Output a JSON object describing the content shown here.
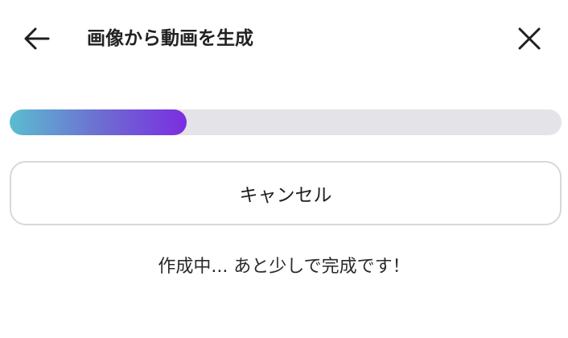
{
  "header": {
    "title": "画像から動画を生成",
    "back_icon": "arrow-left-icon",
    "close_icon": "close-icon"
  },
  "progress": {
    "value_percent": 32,
    "gradient_colors": [
      "#5bbdd0",
      "#6d6fd2",
      "#7a2ee0"
    ],
    "track_color": "#e4e4e8"
  },
  "actions": {
    "cancel_label": "キャンセル"
  },
  "status": {
    "message": "作成中... あと少しで完成です！"
  }
}
